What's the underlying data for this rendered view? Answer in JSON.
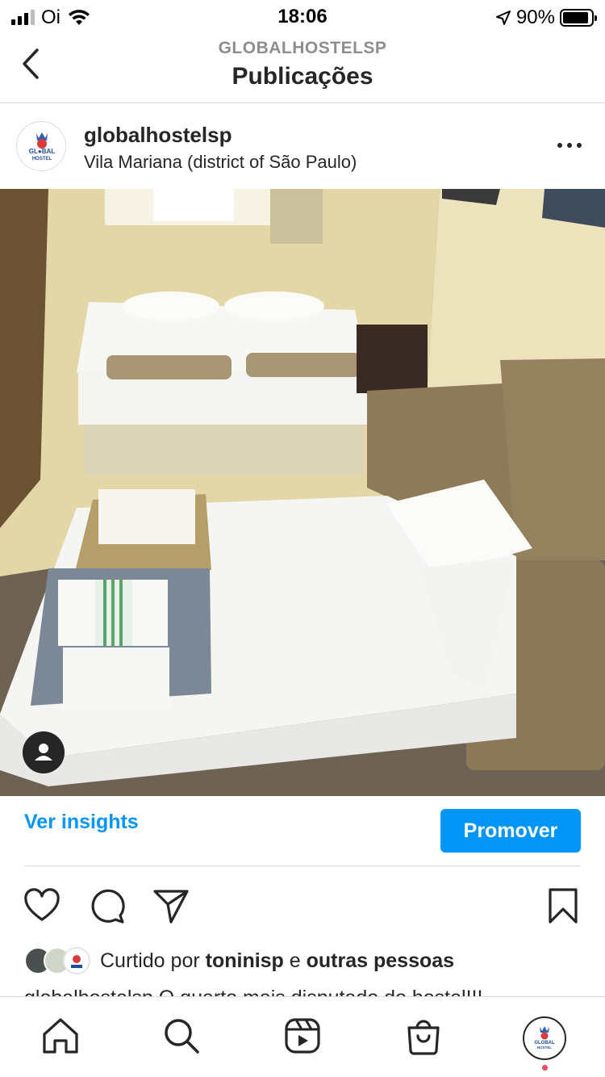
{
  "status_bar": {
    "carrier": "Oi",
    "time": "18:06",
    "battery_percent": "90%",
    "battery_level": 0.9,
    "icons": [
      "signal-icon",
      "wifi-icon",
      "location-arrow-icon",
      "battery-icon"
    ]
  },
  "header": {
    "subtitle": "GLOBALHOSTELSP",
    "title": "Publicações",
    "back_icon": "chevron-left-icon"
  },
  "post": {
    "username": "globalhostelsp",
    "location": "Vila Mariana (district of São Paulo)",
    "more_icon": "more-horizontal-icon",
    "avatar_text": "GLOBAL HOSTEL",
    "image_description_icon": "user-tag-icon"
  },
  "insights": {
    "link_label": "Ver insights",
    "promote_label": "Promover",
    "accent": "#0095f6"
  },
  "actions": {
    "icons": [
      "heart-icon",
      "comment-icon",
      "share-icon",
      "bookmark-icon"
    ]
  },
  "likes": {
    "prefix": "Curtido por ",
    "user": "toninisp",
    "middle": " e ",
    "others": "outras pessoas"
  },
  "caption": {
    "text": "globalhostelsp O quarto mais disputado do hostel!!!"
  },
  "bottom_nav": {
    "items": [
      "home-icon",
      "search-icon",
      "reels-icon",
      "shop-icon",
      "profile-avatar"
    ],
    "notification_color": "#ed4956"
  }
}
